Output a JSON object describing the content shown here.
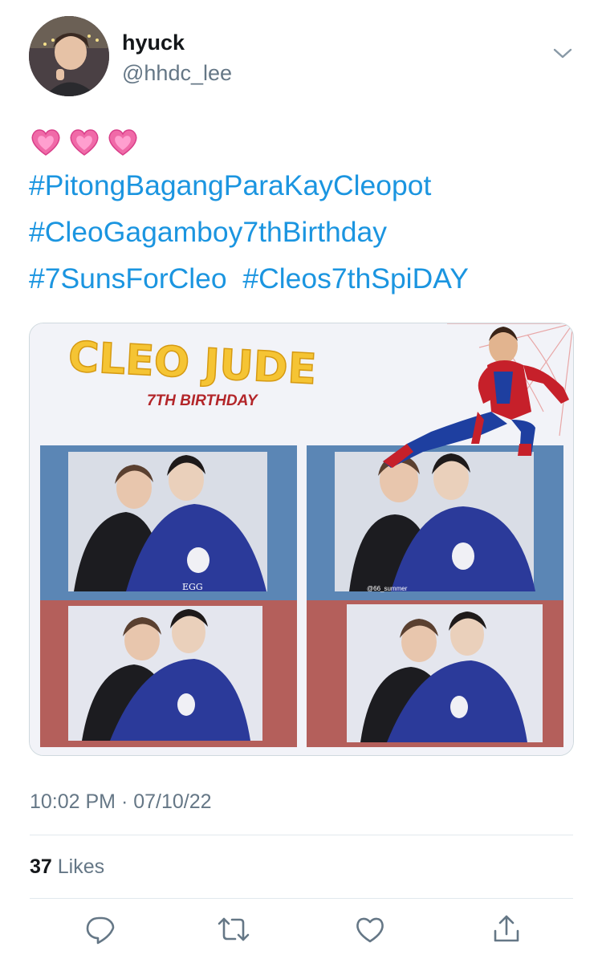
{
  "user": {
    "display_name": "hyuck",
    "handle": "@hhdc_lee"
  },
  "tweet": {
    "emoji": [
      "heart-icon",
      "heart-icon",
      "heart-icon"
    ],
    "hashtags": [
      "#PitongBagangParaKayCleopot",
      "#CleoGagamboy7thBirthday",
      "#7SunsForCleo",
      "#Cleos7thSpiDAY"
    ]
  },
  "media": {
    "title": "CLEO JUDE",
    "subtitle": "7TH BIRTHDAY",
    "watermark": "@66_summer",
    "shirt_text": "EGG",
    "colors": {
      "blue_panel": "#5b86b5",
      "red_panel": "#b45f5b",
      "title_yellow": "#f5c434",
      "subtitle_red": "#b3262a"
    }
  },
  "meta": {
    "timestamp": "10:02 PM · 07/10/22",
    "likes_count": "37",
    "likes_label": "Likes"
  },
  "actions": [
    "reply-icon",
    "retweet-icon",
    "like-icon",
    "share-icon"
  ],
  "colors": {
    "link": "#1b95e0",
    "secondary_text": "#657786",
    "divider": "#e1e8ed"
  }
}
